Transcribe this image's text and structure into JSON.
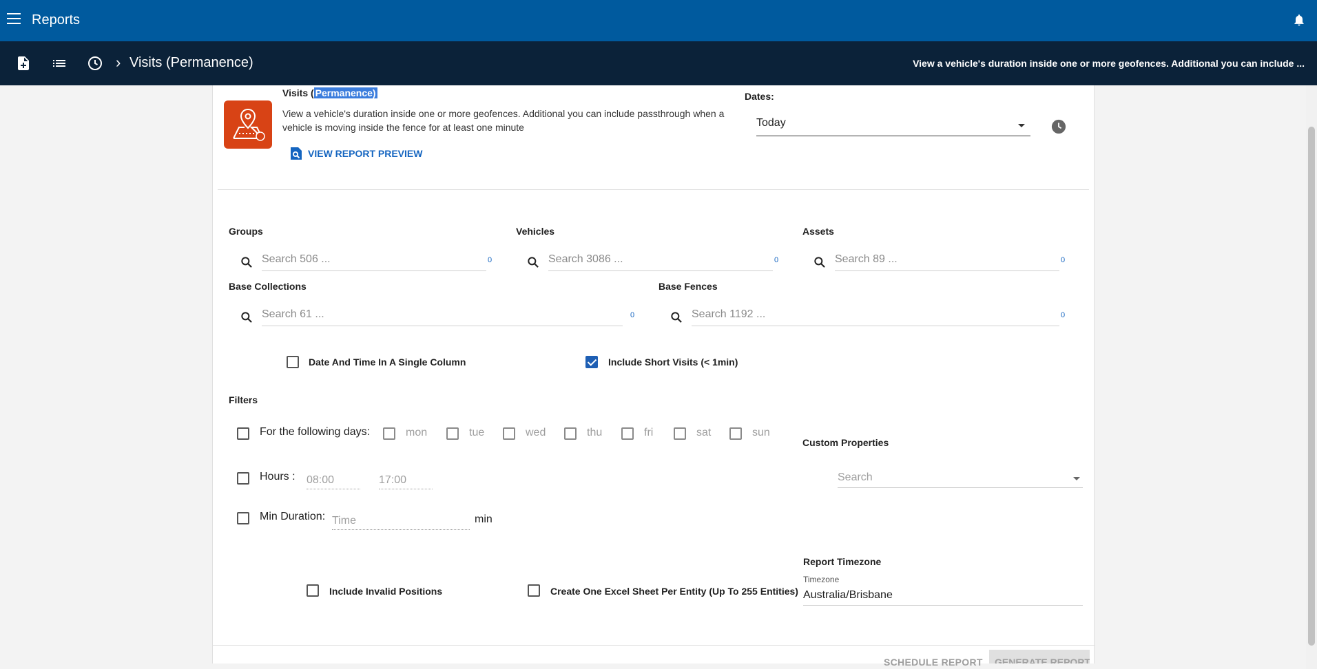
{
  "app": {
    "title": "Reports"
  },
  "subheader": {
    "breadcrumb": "Visits (Permanence)",
    "description": "View a vehicle's duration inside one or more geofences. Additional you can include ..."
  },
  "report": {
    "name_prefix": "Visits (",
    "name_highlight": "Permanence)",
    "description": "View a vehicle's duration inside one or more geofences. Additional you can include passthrough when a vehicle is moving inside the fence for at least one minute",
    "preview_label": "VIEW REPORT PREVIEW"
  },
  "dates": {
    "label": "Dates:",
    "value": "Today"
  },
  "selectors": {
    "groups": {
      "label": "Groups",
      "placeholder": "Search 506  ...",
      "count": "0"
    },
    "vehicles": {
      "label": "Vehicles",
      "placeholder": "Search 3086  ...",
      "count": "0"
    },
    "assets": {
      "label": "Assets",
      "placeholder": "Search 89  ...",
      "count": "0"
    },
    "base_collections": {
      "label": "Base Collections",
      "placeholder": "Search 61  ...",
      "count": "0"
    },
    "base_fences": {
      "label": "Base Fences",
      "placeholder": "Search 1192  ...",
      "count": "0"
    }
  },
  "options": {
    "date_time_single": {
      "label": "Date And Time In A Single Column",
      "checked": false
    },
    "short_visits": {
      "label": "Include Short Visits (< 1min)",
      "checked": true
    }
  },
  "filters": {
    "label": "Filters",
    "days": {
      "label": "For the following days:",
      "items": [
        "mon",
        "tue",
        "wed",
        "thu",
        "fri",
        "sat",
        "sun"
      ]
    },
    "hours": {
      "label": "Hours :",
      "from": "08:00",
      "to": "17:00"
    },
    "min_duration": {
      "label": "Min Duration:",
      "placeholder": "Time",
      "unit": "min"
    }
  },
  "custom_properties": {
    "label": "Custom Properties",
    "placeholder": "Search"
  },
  "bottom_options": {
    "invalid_positions": "Include Invalid Positions",
    "excel_sheet": "Create One Excel Sheet Per Entity (Up To 255 Entities)"
  },
  "timezone": {
    "label": "Report Timezone",
    "small_label": "Timezone",
    "value": "Australia/Brisbane"
  },
  "actions": {
    "schedule": "SCHEDULE REPORT",
    "generate": "GENERATE REPORT"
  }
}
